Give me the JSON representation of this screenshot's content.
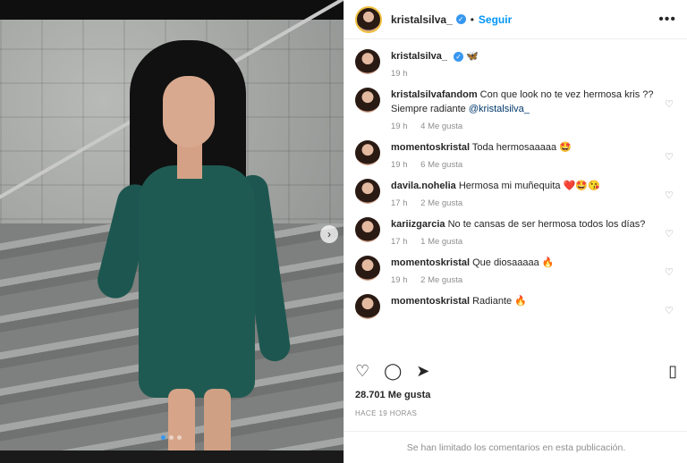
{
  "post": {
    "author": "kristalsilva_",
    "follow_label": "Seguir",
    "separator": "•",
    "caption_emoji": "🦋",
    "caption_time": "19 h",
    "likes": "28.701 Me gusta",
    "posted": "HACE 19 HORAS",
    "comments_limited": "Se han limitado los comentarios en esta publicación."
  },
  "comments": [
    {
      "user": "kristalsilvafandom",
      "text": "Con que look no te vez hermosa kris ?? Siempre radiante ",
      "mention": "@kristalsilva_",
      "time": "19 h",
      "likes": "4 Me gusta"
    },
    {
      "user": "momentoskristal",
      "text": "Toda hermosaaaaa 🤩",
      "mention": "",
      "time": "19 h",
      "likes": "6 Me gusta"
    },
    {
      "user": "davila.nohelia",
      "text": "Hermosa mi muñequita ❤️🤩😘",
      "mention": "",
      "time": "17 h",
      "likes": "2 Me gusta"
    },
    {
      "user": "kariizgarcia",
      "text": "No te cansas de ser hermosa todos los días?",
      "mention": "",
      "time": "17 h",
      "likes": "1 Me gusta"
    },
    {
      "user": "momentoskristal",
      "text": "Que diosaaaaa 🔥",
      "mention": "",
      "time": "19 h",
      "likes": "2 Me gusta"
    },
    {
      "user": "momentoskristal",
      "text": "Radiante 🔥",
      "mention": "",
      "time": "",
      "likes": ""
    }
  ],
  "icons": {
    "verified": "verified-badge-icon",
    "more": "more-options-icon",
    "like": "heart-icon",
    "comment": "comment-icon",
    "share": "share-icon",
    "save": "bookmark-icon",
    "carousel_next": "chevron-right-icon"
  },
  "colors": {
    "accent": "#0095f6",
    "verified": "#3897f0",
    "muted": "#8e8e8e"
  }
}
